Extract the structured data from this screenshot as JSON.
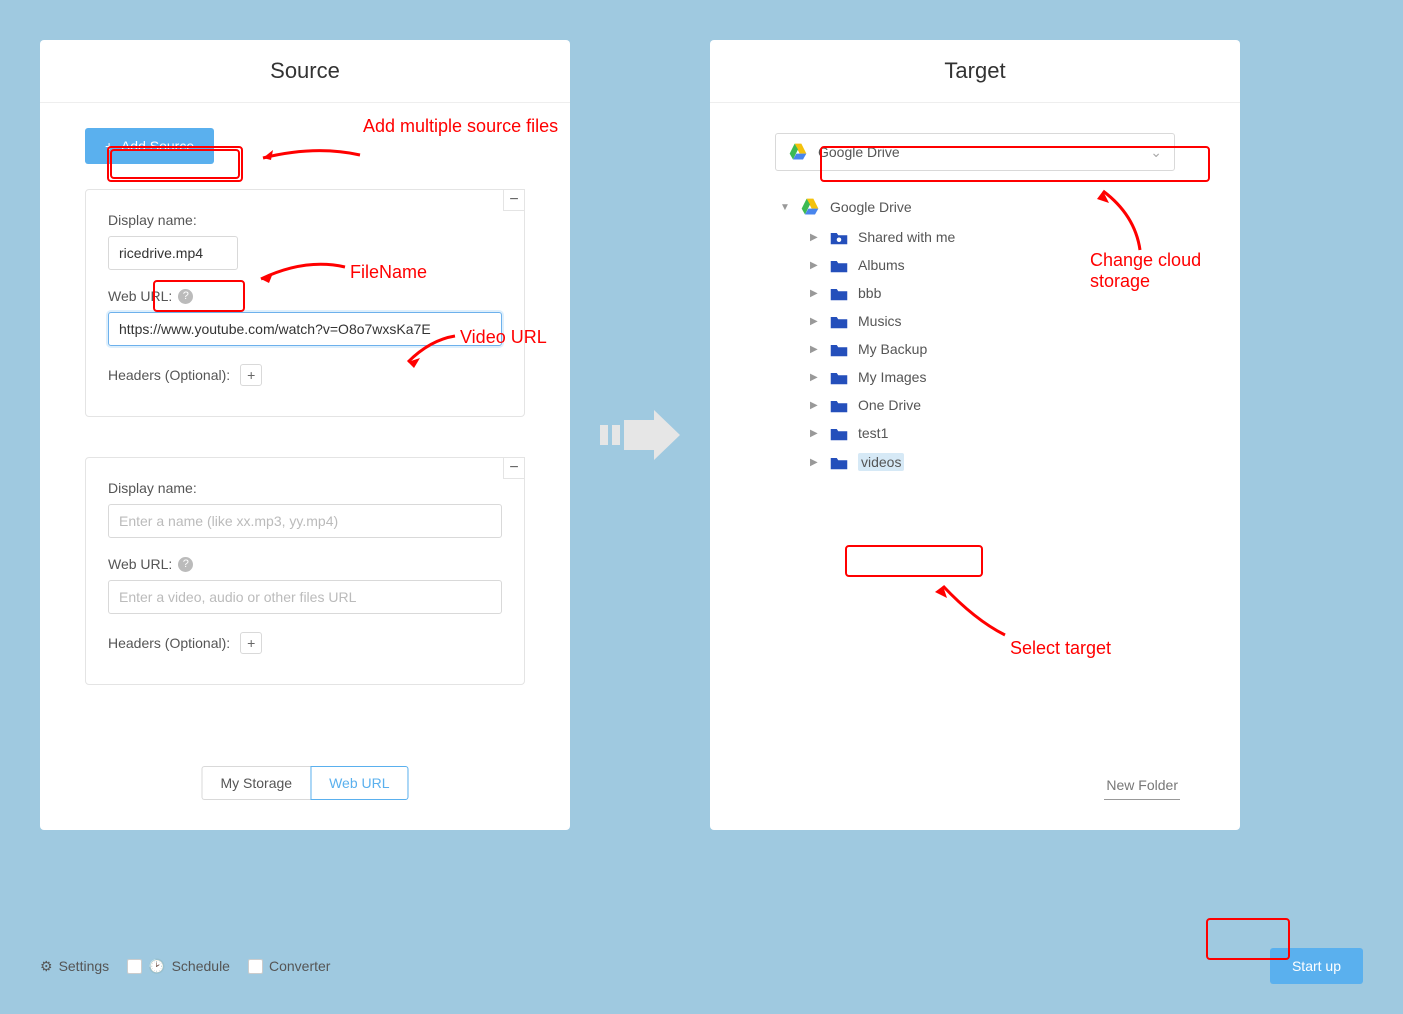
{
  "source": {
    "title": "Source",
    "add_button": "Add Source",
    "cards": [
      {
        "display_label": "Display name:",
        "display_value": "ricedrive.mp4",
        "display_placeholder": "",
        "url_label": "Web URL:",
        "url_value": "https://www.youtube.com/watch?v=O8o7wxsKa7E",
        "url_placeholder": "",
        "headers_label": "Headers (Optional):"
      },
      {
        "display_label": "Display name:",
        "display_value": "",
        "display_placeholder": "Enter a name (like xx.mp3, yy.mp4)",
        "url_label": "Web URL:",
        "url_value": "",
        "url_placeholder": "Enter a video, audio or other files URL",
        "headers_label": "Headers (Optional):"
      }
    ],
    "tabs": {
      "storage": "My Storage",
      "web": "Web URL"
    }
  },
  "target": {
    "title": "Target",
    "selector_label": "Google Drive",
    "root": "Google Drive",
    "folders": [
      "Shared with me",
      "Albums",
      "bbb",
      "Musics",
      "My Backup",
      "My Images",
      "One Drive",
      "test1",
      "videos"
    ],
    "new_folder": "New Folder"
  },
  "footer": {
    "settings": "Settings",
    "schedule": "Schedule",
    "converter": "Converter",
    "startup": "Start up"
  },
  "annotations": {
    "add_multiple": "Add multiple source files",
    "filename": "FileName",
    "video_url": "Video URL",
    "change_cloud": "Change cloud storage",
    "select_target": "Select target"
  }
}
